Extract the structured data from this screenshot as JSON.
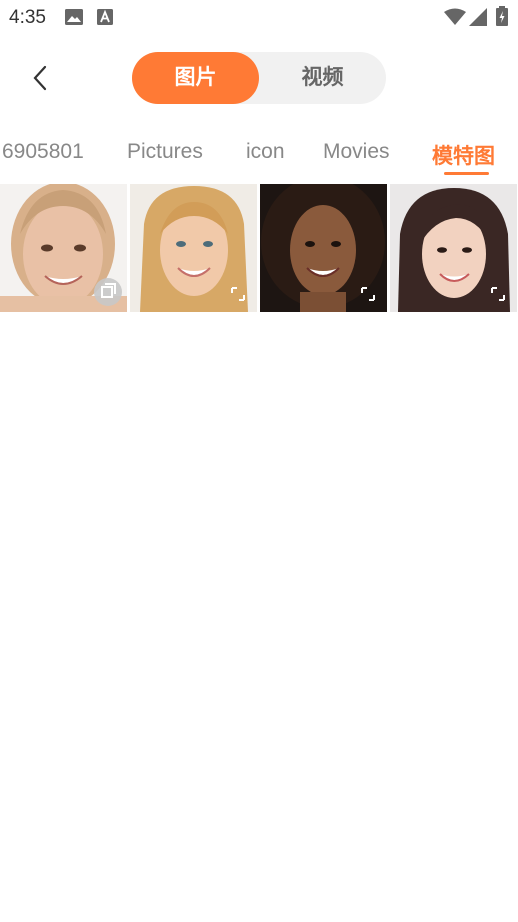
{
  "status": {
    "time": "4:35"
  },
  "toggle": {
    "images_label": "图片",
    "videos_label": "视频"
  },
  "tabs": [
    "6905801",
    "Pictures",
    "icon",
    "Movies",
    "模特图"
  ],
  "active_tab_index": 4,
  "colors": {
    "accent": "#ff7a35",
    "toggle_bg": "#f1f1f1",
    "inactive_text": "#888888"
  },
  "icons": [
    "back-icon",
    "image-icon",
    "a-badge-icon",
    "wifi-icon",
    "signal-icon",
    "battery-icon",
    "expand-icon"
  ],
  "photos": [
    {
      "name": "model-photo-1",
      "selected_badge": true
    },
    {
      "name": "model-photo-2",
      "selected_badge": false
    },
    {
      "name": "model-photo-3",
      "selected_badge": false
    },
    {
      "name": "model-photo-4",
      "selected_badge": false
    }
  ]
}
